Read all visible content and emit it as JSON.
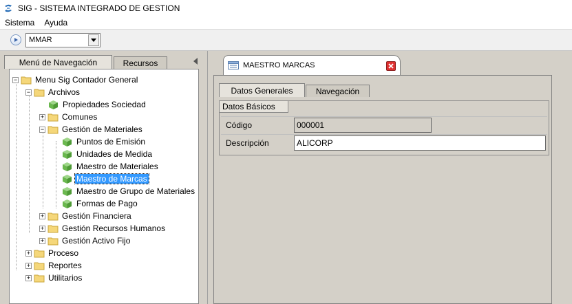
{
  "window": {
    "title": "SIG - SISTEMA INTEGRADO DE GESTION"
  },
  "menubar": {
    "items": [
      "Sistema",
      "Ayuda"
    ]
  },
  "toolbar": {
    "module_combo_value": "MMAR"
  },
  "left_panel": {
    "tabs": [
      "Menú de Navegación",
      "Recursos"
    ],
    "tree": {
      "root": "Menu Sig  Contador General",
      "archivos": "Archivos",
      "propiedades": "Propiedades Sociedad",
      "comunes": "Comunes",
      "gestion_materiales": "Gestión de Materiales",
      "puntos": "Puntos de Emisión",
      "unidades": "Unidades de Medida",
      "maestro_materiales": "Maestro de Materiales",
      "maestro_marcas": "Maestro de Marcas",
      "maestro_grupo": "Maestro de Grupo de Materiales",
      "formas_pago": "Formas de Pago",
      "gestion_financiera": "Gestión Financiera",
      "gestion_rrhh": "Gestión Recursos Humanos",
      "gestion_activo": "Gestión Activo Fijo",
      "proceso": "Proceso",
      "reportes": "Reportes",
      "utilitarios": "Utilitarios"
    }
  },
  "document": {
    "tab_title": "MAESTRO MARCAS",
    "subtabs": [
      "Datos Generales",
      "Navegación"
    ],
    "group_title": "Datos Básicos",
    "fields": {
      "code_label": "Código",
      "code_value": "000001",
      "desc_label": "Descripción",
      "desc_value": "ALICORP"
    }
  },
  "colors": {
    "selection": "#3399ff",
    "panel_bg": "#d4d0c8",
    "close_red": "#e03030"
  }
}
